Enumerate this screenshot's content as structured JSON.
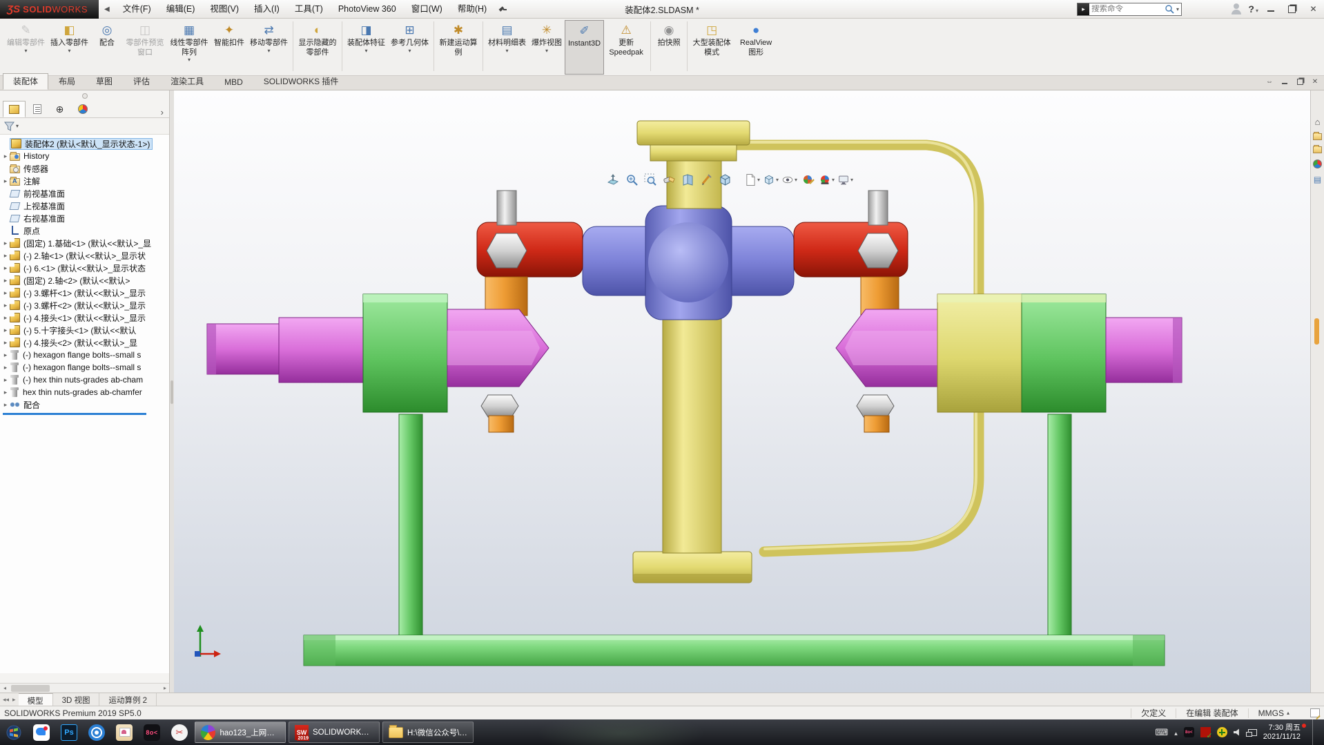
{
  "titlebar": {
    "brand_mark": "ƷS",
    "brand_solid": "SOLID",
    "brand_works": "WORKS",
    "menus": [
      "文件(F)",
      "编辑(E)",
      "视图(V)",
      "插入(I)",
      "工具(T)",
      "PhotoView 360",
      "窗口(W)",
      "帮助(H)"
    ],
    "title": "装配体2.SLDASM *",
    "search_placeholder": "搜索命令",
    "help_label": "?"
  },
  "ribbon": {
    "buttons": [
      {
        "icon": "edit-component-icon",
        "label": "编辑零部件",
        "glyph": "✎",
        "disabled": true,
        "dropdown": true
      },
      {
        "icon": "insert-component-icon",
        "label": "插入零部件",
        "glyph": "◧",
        "dropdown": true
      },
      {
        "icon": "mate-icon",
        "label": "配合",
        "glyph": "◎"
      },
      {
        "icon": "component-preview-icon",
        "label": "零部件预览窗口",
        "glyph": "◫",
        "disabled": true
      },
      {
        "icon": "linear-pattern-icon",
        "label": "线性零部件阵列",
        "glyph": "▦",
        "dropdown": true
      },
      {
        "icon": "smart-fasteners-icon",
        "label": "智能扣件",
        "glyph": "✦"
      },
      {
        "icon": "move-component-icon",
        "label": "移动零部件",
        "glyph": "⇄",
        "dropdown": true
      },
      {
        "icon": "show-hidden-components-icon",
        "label": "显示隐藏的零部件",
        "glyph": "◐"
      },
      {
        "icon": "assembly-features-icon",
        "label": "装配体特征",
        "glyph": "◨",
        "dropdown": true
      },
      {
        "icon": "reference-geometry-icon",
        "label": "参考几何体",
        "glyph": "⊞",
        "dropdown": true
      },
      {
        "icon": "new-motion-study-icon",
        "label": "新建运动算例",
        "glyph": "✱"
      },
      {
        "icon": "bill-of-materials-icon",
        "label": "材料明细表",
        "glyph": "▤",
        "dropdown": true
      },
      {
        "icon": "exploded-view-icon",
        "label": "爆炸视图",
        "glyph": "✳",
        "dropdown": true
      },
      {
        "icon": "instant3d-icon",
        "label": "Instant3D",
        "glyph": "✐",
        "active": true
      },
      {
        "icon": "update-speedpak-icon",
        "label": "更新 Speedpak",
        "glyph": "⚠"
      },
      {
        "icon": "take-snapshot-icon",
        "label": "拍快照",
        "glyph": "◉"
      },
      {
        "icon": "large-assembly-mode-icon",
        "label": "大型装配体模式",
        "glyph": "◳"
      },
      {
        "icon": "realview-graphics-icon",
        "label": "RealView 图形",
        "glyph": "●"
      }
    ]
  },
  "command_tabs": {
    "items": [
      "装配体",
      "布局",
      "草图",
      "评估",
      "渲染工具",
      "MBD",
      "SOLIDWORKS 插件"
    ],
    "active": "装配体"
  },
  "feature_tree": {
    "root": "装配体2 (默认<默认_显示状态-1>)",
    "items": [
      {
        "label": "History",
        "icon": "history-folder-icon",
        "expandable": true
      },
      {
        "label": "传感器",
        "icon": "sensors-folder-icon",
        "expandable": false
      },
      {
        "label": "注解",
        "icon": "annotations-folder-icon",
        "expandable": true
      },
      {
        "label": "前视基准面",
        "icon": "plane-icon",
        "expandable": false
      },
      {
        "label": "上视基准面",
        "icon": "plane-icon",
        "expandable": false
      },
      {
        "label": "右视基准面",
        "icon": "plane-icon",
        "expandable": false
      },
      {
        "label": "原点",
        "icon": "origin-icon",
        "expandable": false
      },
      {
        "label": "(固定) 1.基础<1> (默认<<默认>_显",
        "icon": "part-icon",
        "expandable": true
      },
      {
        "label": "(-) 2.轴<1> (默认<<默认>_显示状",
        "icon": "part-icon",
        "expandable": true
      },
      {
        "label": "(-) 6.<1> (默认<<默认>_显示状态",
        "icon": "part-icon",
        "expandable": true
      },
      {
        "label": "(固定) 2.轴<2> (默认<<默认>",
        "icon": "part-icon",
        "expandable": true
      },
      {
        "label": "(-) 3.螺杆<1> (默认<<默认>_显示",
        "icon": "part-icon",
        "expandable": true
      },
      {
        "label": "(-) 3.螺杆<2> (默认<<默认>_显示",
        "icon": "part-icon",
        "expandable": true
      },
      {
        "label": "(-) 4.接头<1> (默认<<默认>_显示",
        "icon": "part-icon",
        "expandable": true
      },
      {
        "label": "(-) 5.十字接头<1> (默认<<默认",
        "icon": "part-icon",
        "expandable": true
      },
      {
        "label": "(-) 4.接头<2> (默认<<默认>_显",
        "icon": "part-icon",
        "expandable": true
      },
      {
        "label": "(-) hexagon flange bolts--small s",
        "icon": "bolt-icon",
        "expandable": true
      },
      {
        "label": "(-) hexagon flange bolts--small s",
        "icon": "bolt-icon",
        "expandable": true
      },
      {
        "label": "(-) hex thin nuts-grades ab-cham",
        "icon": "bolt-icon",
        "expandable": true
      },
      {
        "label": "hex thin nuts-grades ab-chamfer",
        "icon": "bolt-icon",
        "expandable": true
      },
      {
        "label": "配合",
        "icon": "mates-icon",
        "expandable": true
      }
    ]
  },
  "viewport": {
    "headsup_icons": [
      "zoom-fit",
      "zoom-area",
      "previous-view",
      "section-view",
      "pane-view",
      "annotation-edit",
      "iso-cube",
      "drawing-sheet",
      "view-orientation",
      "display-style",
      "edit-appearance",
      "apply-scene",
      "view-settings"
    ],
    "model_parts": [
      "yellow-pipe",
      "green-base-plate",
      "left-green-leg",
      "right-green-leg",
      "bottom-yellow-flange",
      "center-yellow-column",
      "blue-cross-block",
      "top-yellow-flange",
      "left-red-bracket",
      "right-red-bracket",
      "left-hex-bolt",
      "right-hex-bolt",
      "left-orange-bushing",
      "right-orange-bushing",
      "left-pink-shaft",
      "left-green-block",
      "left-pink-hex-coupler",
      "right-pink-hex-coupler",
      "right-yellow-green-block",
      "right-pink-shaft",
      "left-hex-nut",
      "right-hex-nut",
      "origin-triad"
    ],
    "colors": {
      "yellow": "#e6dd76",
      "blue": "#7f84d9",
      "red": "#d23726",
      "orange": "#ec9c3c",
      "pink": "#dd76dd",
      "green": "#6fcf6f",
      "steel": "#d9d9d9",
      "background_top": "#fcfcfd",
      "background_bottom": "#ccd3de"
    }
  },
  "task_pane": {
    "icons": [
      "home",
      "design-library",
      "file-explorer",
      "appearances",
      "custom-properties"
    ]
  },
  "doc_tabs": {
    "items": [
      "模型",
      "3D 视图",
      "运动算例 2"
    ],
    "active": "模型"
  },
  "statusbar": {
    "left": "SOLIDWORKS Premium 2019 SP5.0",
    "defined": "欠定义",
    "editing": "在编辑 装配体",
    "units": "MMGS"
  },
  "taskbar": {
    "ps_label": "Ps",
    "boke_label": "8o<",
    "sw_mark": "SW",
    "sw_badge": "2019",
    "windows": [
      {
        "icon": "browser-pinwheel",
        "label": "hao123_上网从..."
      },
      {
        "icon": "solidworks-2019",
        "label": "SOLIDWORKS P..."
      },
      {
        "icon": "folder",
        "label": "H:\\微信公众号\\1..."
      }
    ],
    "clock": {
      "time": "7:30 周五",
      "date": "2021/11/12"
    }
  }
}
